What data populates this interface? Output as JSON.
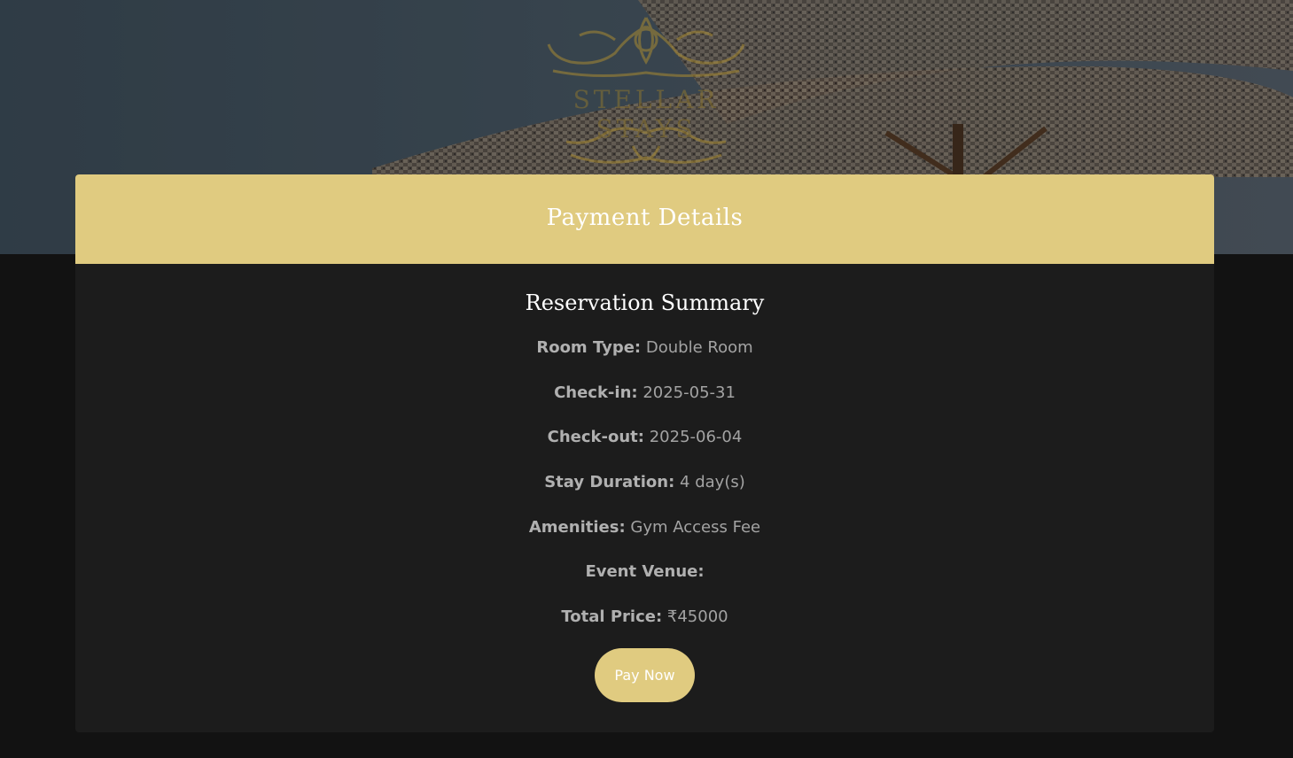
{
  "brand": {
    "logo_text": "STELLAR STAYS"
  },
  "card": {
    "title": "Payment Details"
  },
  "summary": {
    "title": "Reservation Summary",
    "room_type": {
      "label": "Room Type:",
      "value": "Double Room"
    },
    "check_in": {
      "label": "Check-in:",
      "value": "2025-05-31"
    },
    "check_out": {
      "label": "Check-out:",
      "value": "2025-06-04"
    },
    "stay_duration": {
      "label": "Stay Duration:",
      "value": "4 day(s)"
    },
    "amenities": {
      "label": "Amenities:",
      "value": "Gym Access Fee"
    },
    "event_venue": {
      "label": "Event Venue:",
      "value": ""
    },
    "total_price": {
      "label": "Total Price:",
      "value": "₹45000"
    }
  },
  "actions": {
    "pay_label": "Pay Now"
  },
  "colors": {
    "accent": "#e0cb80",
    "card_bg": "#1c1c1c",
    "page_bg": "#121212",
    "text_muted": "#a3a3a3"
  }
}
